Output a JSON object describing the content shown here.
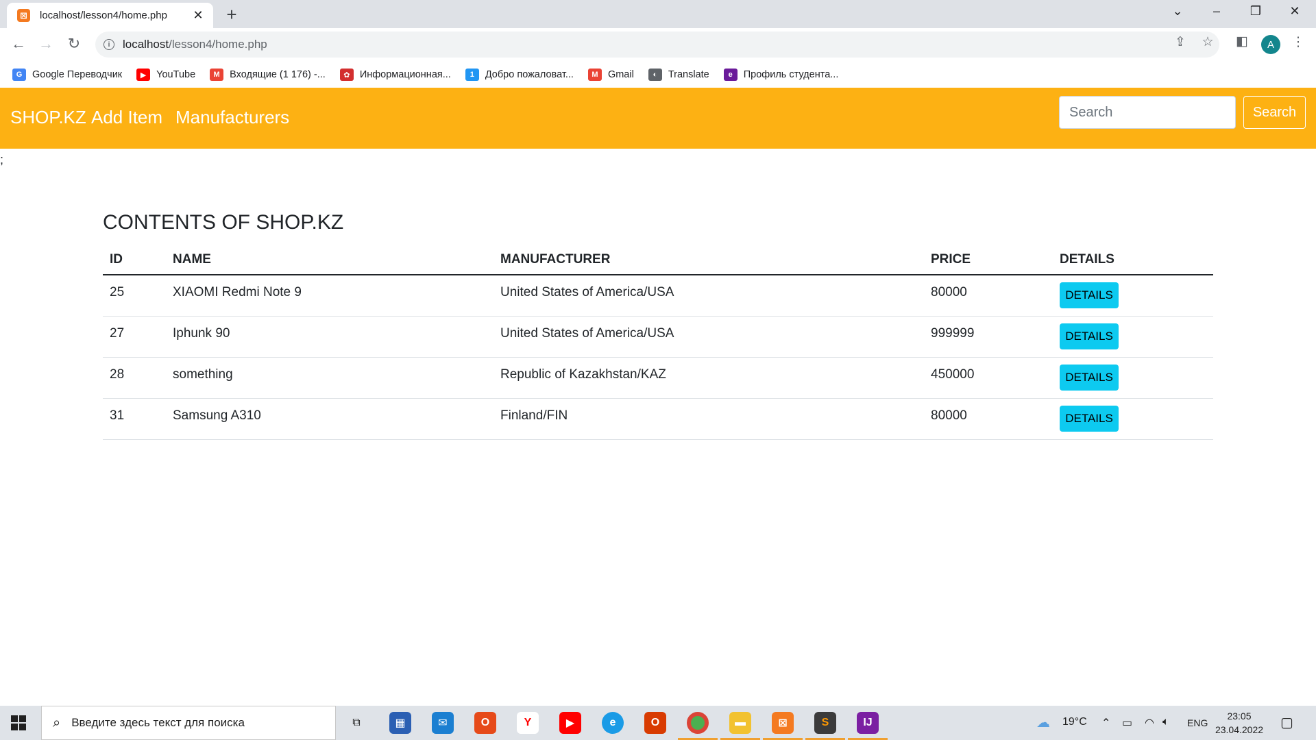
{
  "browser": {
    "tab_title": "localhost/lesson4/home.php",
    "url_host": "localhost",
    "url_path": "/lesson4/home.php",
    "avatar_letter": "A",
    "bookmarks": [
      {
        "label": "Google Переводчик",
        "icon": "translate-icon",
        "color": "#4285f4",
        "glyph": "G"
      },
      {
        "label": "YouTube",
        "icon": "youtube-icon",
        "color": "#ff0000",
        "glyph": "▶"
      },
      {
        "label": "Входящие (1 176) -...",
        "icon": "gmail-icon",
        "color": "#ea4335",
        "glyph": "M"
      },
      {
        "label": "Информационная...",
        "icon": "portal-icon",
        "color": "#d32f2f",
        "glyph": "✿"
      },
      {
        "label": "Добро пожаловат...",
        "icon": "welcome-icon",
        "color": "#2196f3",
        "glyph": "1"
      },
      {
        "label": "Gmail",
        "icon": "gmail-icon",
        "color": "#ea4335",
        "glyph": "M"
      },
      {
        "label": "Translate",
        "icon": "globe-icon",
        "color": "#5f6368",
        "glyph": "◐"
      },
      {
        "label": "Профиль студента...",
        "icon": "student-profile-icon",
        "color": "#6a1b9a",
        "glyph": "e"
      }
    ]
  },
  "navbar": {
    "brand": "SHOP.KZ",
    "links": [
      "Add Item",
      "Manufacturers"
    ],
    "search_placeholder": "Search",
    "search_button": "Search",
    "accent": "#fdb113"
  },
  "stray_text": ";",
  "main": {
    "heading": "CONTENTS OF SHOP.KZ",
    "columns": [
      "ID",
      "NAME",
      "MANUFACTURER",
      "PRICE",
      "DETAILS"
    ],
    "rows": [
      {
        "id": "25",
        "name": "XIAOMI Redmi Note 9",
        "manufacturer": "United States of America/USA",
        "price": "80000",
        "details": "DETAILS"
      },
      {
        "id": "27",
        "name": "Iphunk 90",
        "manufacturer": "United States of America/USA",
        "price": "999999",
        "details": "DETAILS"
      },
      {
        "id": "28",
        "name": "something",
        "manufacturer": "Republic of Kazakhstan/KAZ",
        "price": "450000",
        "details": "DETAILS"
      },
      {
        "id": "31",
        "name": "Samsung A310",
        "manufacturer": "Finland/FIN",
        "price": "80000",
        "details": "DETAILS"
      }
    ],
    "button_color": "#0dcaf0"
  },
  "taskbar": {
    "search_placeholder": "Введите здесь текст для поиска",
    "temperature": "19°C",
    "language": "ENG",
    "time": "23:05",
    "date": "23.04.2022"
  }
}
